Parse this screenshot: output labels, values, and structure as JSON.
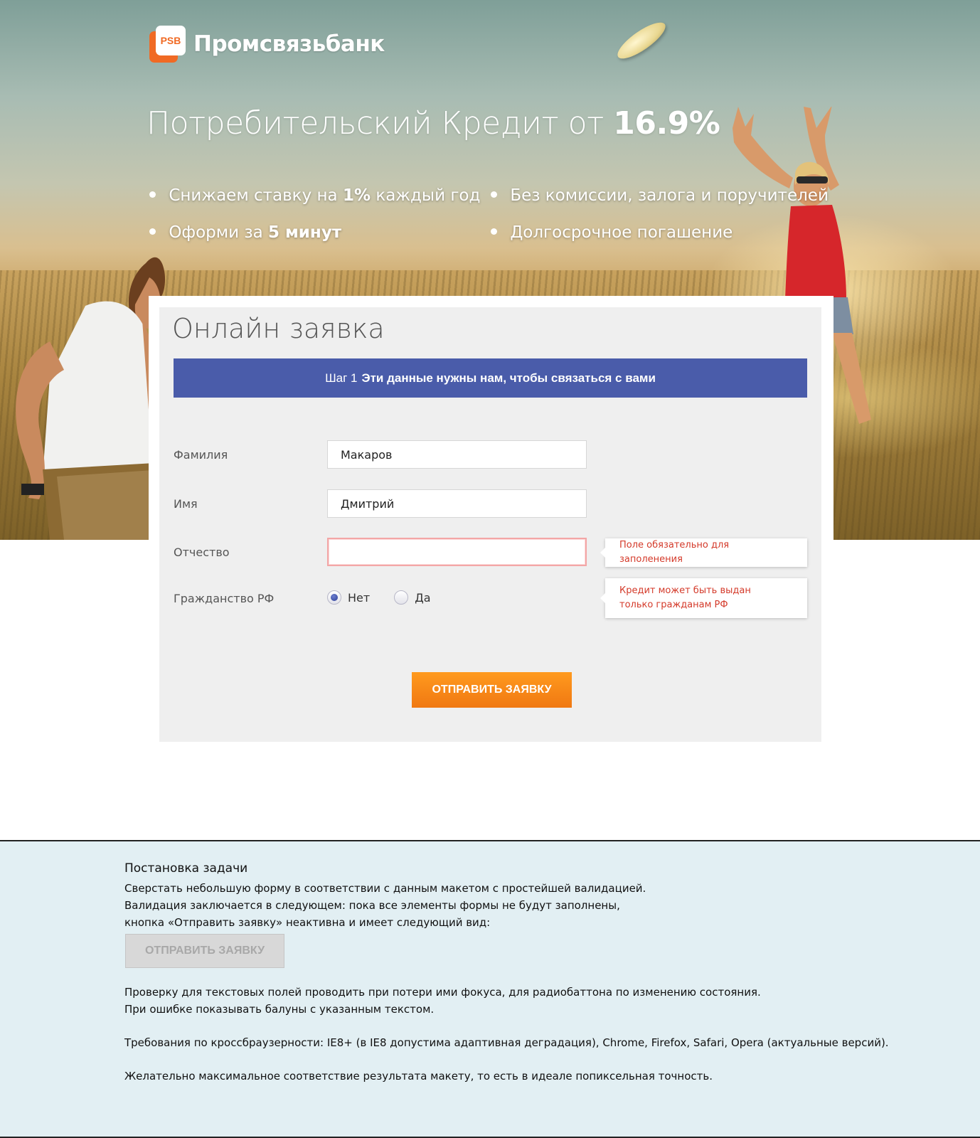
{
  "brand": {
    "name": "Промсвязьбанк",
    "mark": "PSB",
    "color": "#f06a24"
  },
  "hero": {
    "headline_prefix": "Потребительский Кредит от",
    "headline_rate": "16.9%",
    "features": [
      {
        "pre": "Снижаем ставку на",
        "bold": "1%",
        "post": "каждый год"
      },
      {
        "pre": "Оформи за",
        "bold": "5 минут",
        "post": ""
      },
      {
        "pre": "Без комиссии, залога и поручителей",
        "bold": "",
        "post": ""
      },
      {
        "pre": "Долгосрочное погашение",
        "bold": "",
        "post": ""
      }
    ]
  },
  "form": {
    "title": "Онлайн заявка",
    "step_label": "Шаг 1",
    "step_text": "Эти данные нужны нам, чтобы связаться с вами",
    "step_color": "#4a5caa",
    "fields": {
      "surname": {
        "label": "Фамилия",
        "value": "Макаров"
      },
      "name": {
        "label": "Имя",
        "value": "Дмитрий"
      },
      "patronymic": {
        "label": "Отчество",
        "value": ""
      }
    },
    "citizenship": {
      "label": "Гражданство РФ",
      "options": [
        "Нет",
        "Да"
      ],
      "selected": "Нет"
    },
    "errors": {
      "patronymic": "Поле обязательно для заполенения",
      "citizenship_line1": "Кредит может быть выдан",
      "citizenship_line2": "только гражданам РФ",
      "color": "#d43a2a"
    },
    "submit_label": "Отправить заявку",
    "submit_color": "#f07812"
  },
  "task": {
    "title": "Постановка задачи",
    "lines": [
      "Сверстать небольшую форму в соответствии с данным макетом с простейшей валидацией.",
      "Валидация заключается в следующем: пока все элементы формы не будут заполнены,",
      " кнопка «Отправить заявку» неактивна и имеет следующий вид:",
      "Проверку для текстовых полей проводить при потери ими фокуса, для радиобаттона по изменению состояния.",
      "При ошибке показывать балуны с указанным текстом.",
      "Требования по кроссбраузерности: IE8+ (в IE8 допустима адаптивная деградация), Chrome, Firefox, Safari, Opera (актуальные версий).",
      "Желательно максимальное соответствие результата макету, то есть в идеале попиксельная точность."
    ],
    "disabled_button_label": "Отправить заявку"
  }
}
